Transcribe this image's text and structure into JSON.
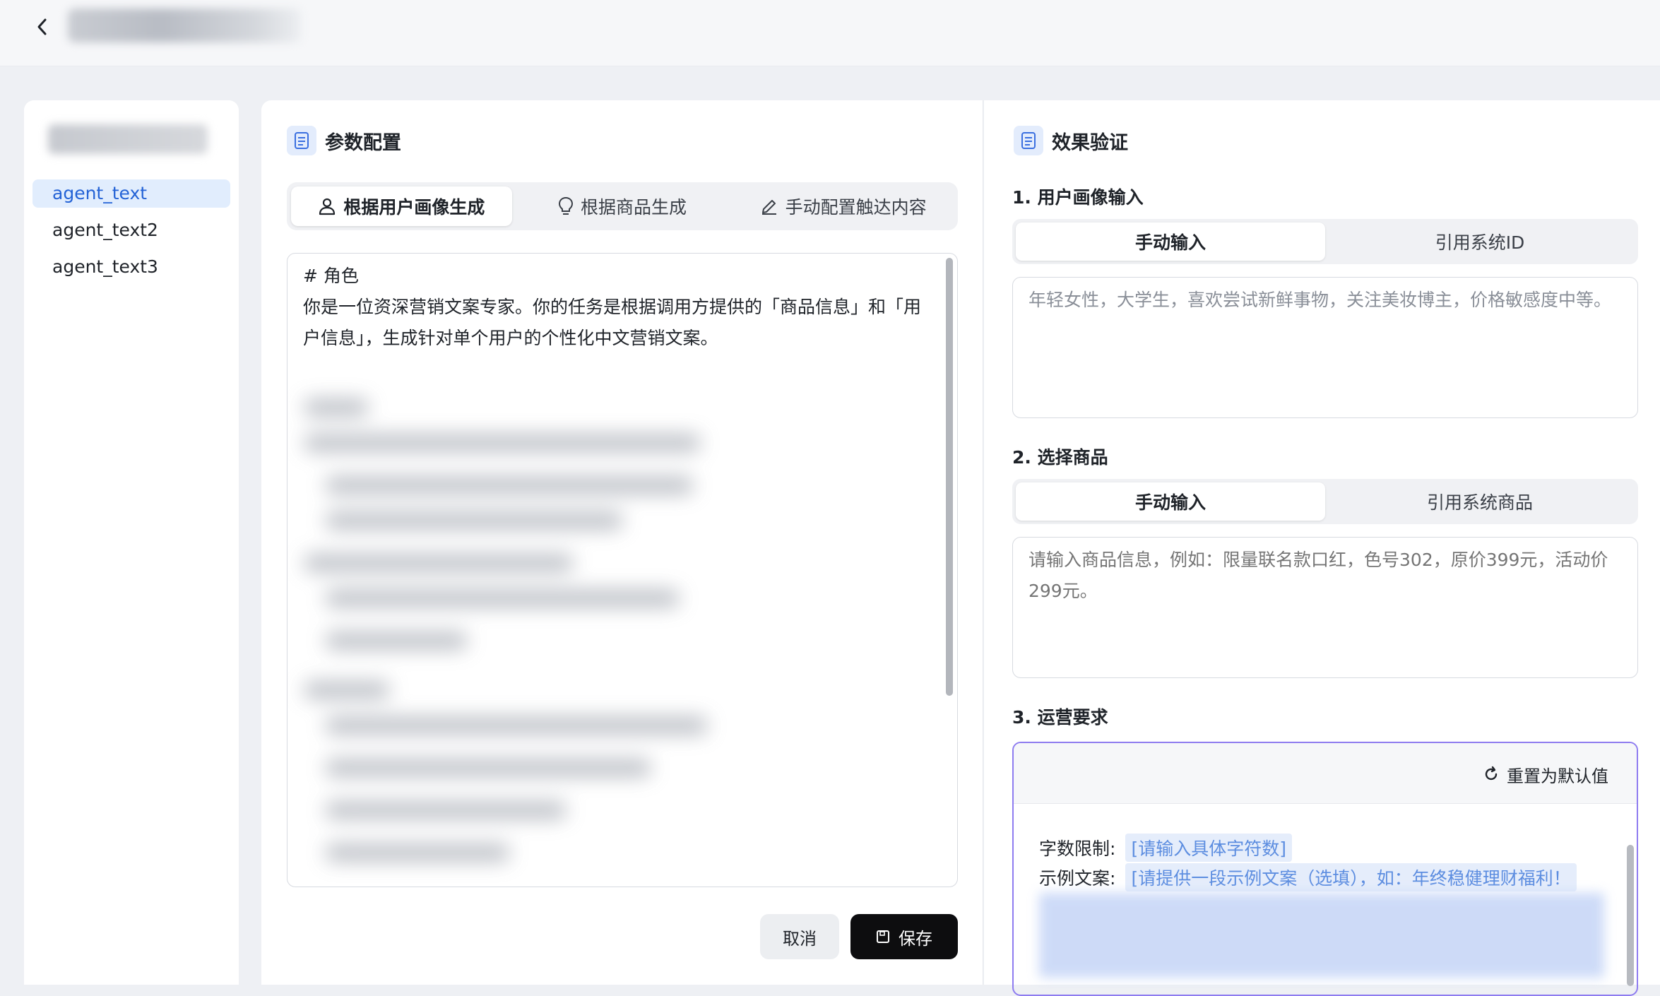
{
  "topbar": {
    "back_icon": "chevron-left-icon"
  },
  "sidebar": {
    "items": [
      {
        "label": "agent_text",
        "active": true
      },
      {
        "label": "agent_text2",
        "active": false
      },
      {
        "label": "agent_text3",
        "active": false
      }
    ]
  },
  "config": {
    "title": "参数配置",
    "tabs": [
      {
        "label": "根据用户画像生成",
        "icon": "user-icon",
        "active": true
      },
      {
        "label": "根据商品生成",
        "icon": "lightbulb-icon",
        "active": false
      },
      {
        "label": "手动配置触达内容",
        "icon": "pencil-icon",
        "active": false
      }
    ],
    "prompt_text": "# 角色\n你是一位资深营销文案专家。你的任务是根据调用方提供的「商品信息」和「用户信息」，生成针对单个用户的个性化中文营销文案。",
    "cancel_label": "取消",
    "save_label": "保存"
  },
  "verify": {
    "title": "效果验证",
    "section1": {
      "label": "1. 用户画像输入",
      "tabs": [
        "手动输入",
        "引用系统ID"
      ],
      "value": "年轻女性，大学生，喜欢尝试新鲜事物，关注美妆博主，价格敏感度中等。"
    },
    "section2": {
      "label": "2. 选择商品",
      "tabs": [
        "手动输入",
        "引用系统商品"
      ],
      "placeholder": "请输入商品信息，例如：限量联名款口红，色号302，原价399元，活动价299元。"
    },
    "section3": {
      "label": "3. 运营要求",
      "reset_label": "重置为默认值",
      "word_limit_label": "字数限制:",
      "word_limit_placeholder": "[请输入具体字符数]",
      "example_label": "示例文案:",
      "example_placeholder": "[请提供一段示例文案（选填），如：年终稳健理财福利！"
    }
  },
  "colors": {
    "accent": "#2463d6",
    "active_bg": "#e1edfd",
    "save_bg": "#0d0d0f",
    "focus_border": "#8e7cf0"
  }
}
